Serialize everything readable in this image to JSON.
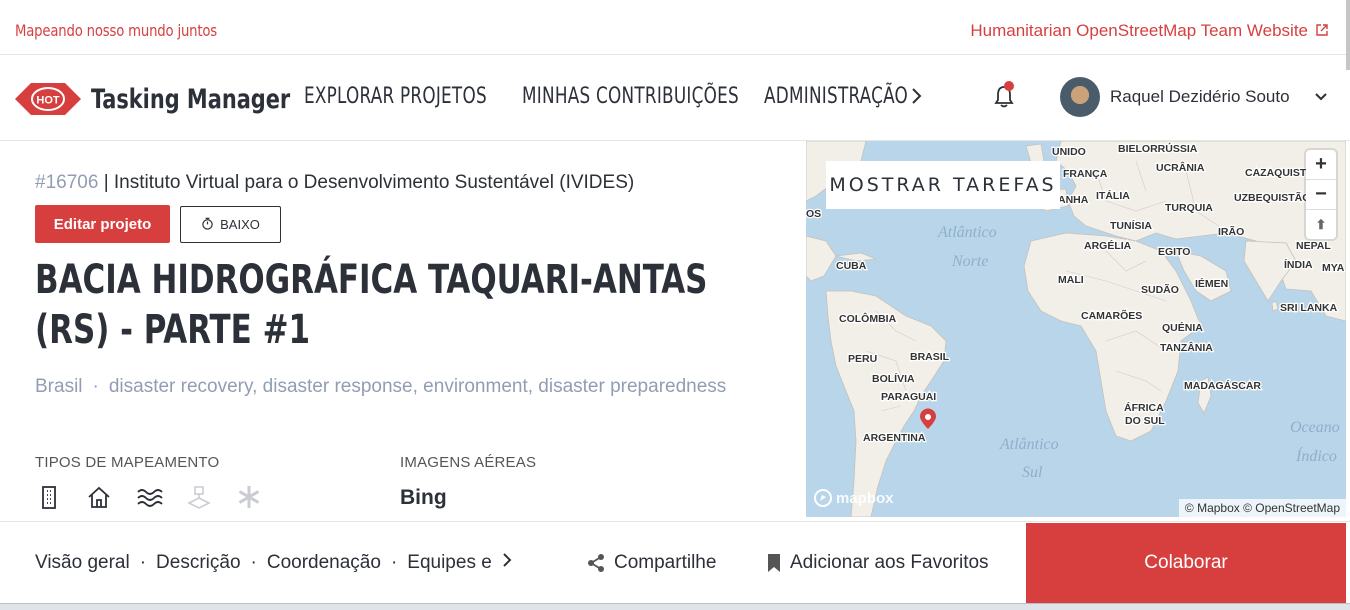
{
  "topbar": {
    "tagline": "Mapeando nosso mundo juntos",
    "hot_link": "Humanitarian OpenStreetMap Team Website"
  },
  "nav": {
    "logo_badge": "HOT",
    "logo_text": "Tasking Manager",
    "links": [
      "EXPLORAR PROJETOS",
      "MINHAS CONTRIBUIÇÕES",
      "ADMINISTRAÇÃO"
    ],
    "user_name": "Raquel Dezidério Souto"
  },
  "project": {
    "id": "#16706",
    "org": "| Instituto Virtual para o Desenvolvimento Sustentável (IVIDES)",
    "edit_label": "Editar projeto",
    "priority_label": "BAIXO",
    "title": "BACIA HIDROGRÁFICA TAQUARI-ANTAS (RS) - PARTE #1",
    "country": "Brasil",
    "tags": "disaster recovery, disaster response, environment, disaster preparedness",
    "mapping_types_label": "TIPOS DE MAPEAMENTO",
    "imagery_label": "IMAGENS AÉREAS",
    "imagery_value": "Bing",
    "mapping_type_icons": [
      "building-icon",
      "house-icon",
      "waterways-icon",
      "landuse-icon",
      "other-icon"
    ]
  },
  "map": {
    "show_tasks": "MOSTRAR TAREFAS",
    "attribution": "© Mapbox © OpenStreetMap",
    "mapbox_logo": "mapbox",
    "labels": [
      "UNIDO",
      "BIELORRÚSSIA",
      "UCRÂNIA",
      "FRANÇA",
      "CAZAQUISTÃO",
      "ANHA",
      "ITÁLIA",
      "TURQUIA",
      "UZBEQUISTÃO",
      "TUNÍSIA",
      "IRÃO",
      "Atlântico",
      "Norte",
      "ARGÉLIA",
      "EGITO",
      "NEPAL",
      "CUBA",
      "ÍNDIA",
      "MYA",
      "MALI",
      "SUDÃO",
      "IÉMEN",
      "SRI LANKA",
      "COLÔMBIA",
      "CAMARÕES",
      "QUÉNIA",
      "BRASIL",
      "TANZÂNIA",
      "PERU",
      "BOLÍVIA",
      "MADAGÁSCAR",
      "PARAGUAI",
      "ÁFRICA",
      "DO SUL",
      "ARGENTINA",
      "Atlântico",
      "Sul",
      "Oceano",
      "Índico",
      "OS"
    ],
    "zoom_in": "+",
    "zoom_out": "−",
    "compass": "⬆"
  },
  "bottom": {
    "sections": [
      "Visão geral",
      "Descrição",
      "Coordenação",
      "Equipes e"
    ],
    "share_label": "Compartilhe",
    "favorite_label": "Adicionar aos Favoritos",
    "collaborate_label": "Colaborar"
  },
  "colors": {
    "brand_red": "#d73f3f",
    "text_dark": "#2c3038",
    "muted": "#929db3",
    "ocean": "#b9d5ea",
    "land": "#f2efe9"
  }
}
